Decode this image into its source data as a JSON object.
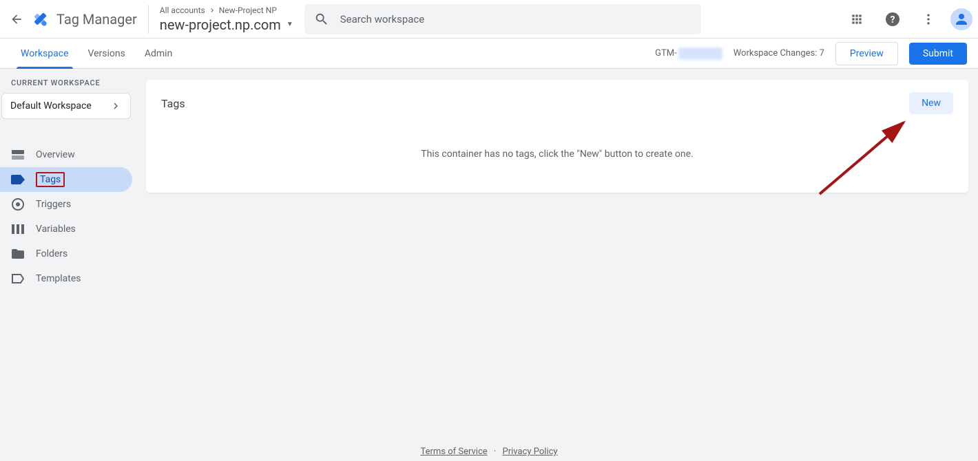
{
  "header": {
    "app_name": "Tag Manager",
    "breadcrumb_root": "All accounts",
    "breadcrumb_leaf": "New-Project NP",
    "container_name": "new-project.np.com",
    "search_placeholder": "Search workspace"
  },
  "subbar": {
    "tabs": [
      "Workspace",
      "Versions",
      "Admin"
    ],
    "gtm_prefix": "GTM-",
    "changes_label": "Workspace Changes:",
    "changes_count": "7",
    "preview": "Preview",
    "submit": "Submit"
  },
  "sidebar": {
    "section_label": "CURRENT WORKSPACE",
    "workspace_name": "Default Workspace",
    "nav": [
      "Overview",
      "Tags",
      "Triggers",
      "Variables",
      "Folders",
      "Templates"
    ]
  },
  "card": {
    "title": "Tags",
    "new_label": "New",
    "empty": "This container has no tags, click the \"New\" button to create one."
  },
  "footer": {
    "terms": "Terms of Service",
    "privacy": "Privacy Policy"
  }
}
